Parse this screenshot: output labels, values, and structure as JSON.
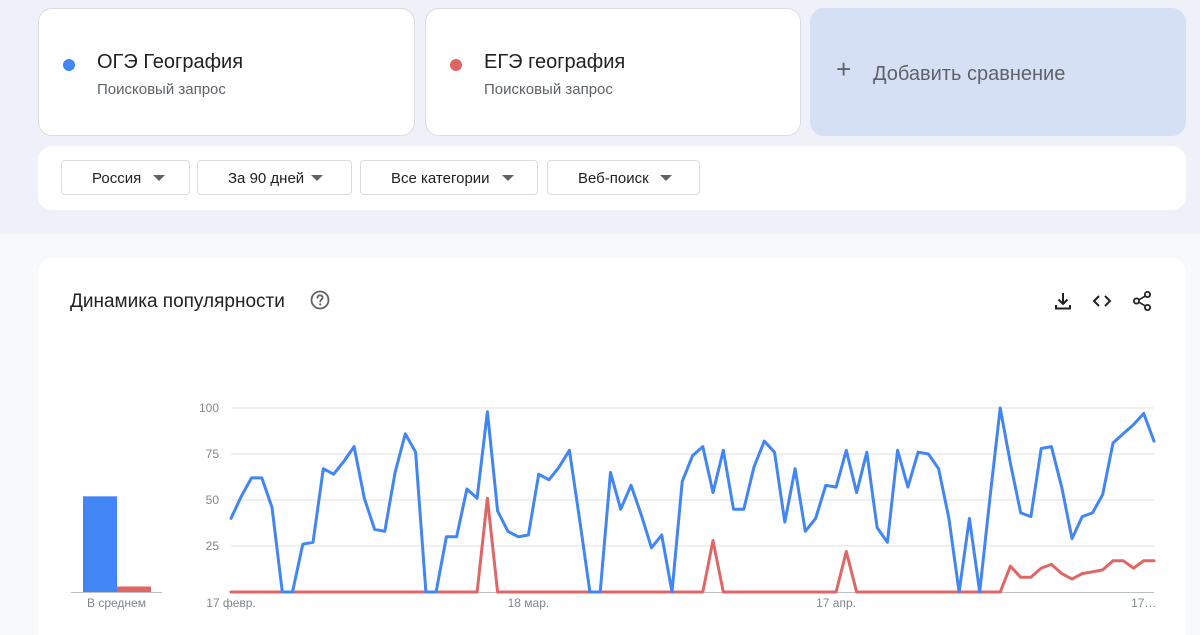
{
  "terms": [
    {
      "name": "ОГЭ География",
      "subtitle": "Поисковый запрос",
      "color": "#4285f4"
    },
    {
      "name": "ЕГЭ география",
      "subtitle": "Поисковый запрос",
      "color": "#e06666"
    }
  ],
  "add_comparison": {
    "icon": "plus-icon",
    "label": "Добавить сравнение"
  },
  "filters": [
    {
      "label": "Россия"
    },
    {
      "label": "За 90 дней"
    },
    {
      "label": "Все категории"
    },
    {
      "label": "Веб-поиск"
    }
  ],
  "chart_card": {
    "title": "Динамика популярности",
    "icons": [
      "help-icon",
      "download-icon",
      "embed-icon",
      "share-icon"
    ]
  },
  "chart_data": {
    "type": "line",
    "y_ticks": [
      "100",
      "75",
      "50",
      "25"
    ],
    "ylim": [
      0,
      100
    ],
    "x_tick_labels": [
      "17 февр.",
      "18 мар.",
      "17 апр.",
      "17…"
    ],
    "x_tick_indices": [
      0,
      29,
      59,
      89
    ],
    "grid": true,
    "average_label": "В среднем",
    "averages": [
      52,
      3
    ],
    "series": [
      {
        "name": "ОГЭ География",
        "color": "#4285f4",
        "values": [
          40,
          52,
          62,
          62,
          46,
          0,
          0,
          26,
          27,
          67,
          64,
          71,
          79,
          51,
          34,
          33,
          65,
          86,
          76,
          0,
          0,
          30,
          30,
          56,
          51,
          98,
          44,
          33,
          30,
          31,
          64,
          61,
          68,
          77,
          39,
          0,
          0,
          65,
          45,
          58,
          42,
          24,
          31,
          0,
          60,
          74,
          79,
          54,
          77,
          45,
          45,
          68,
          82,
          76,
          38,
          67,
          33,
          40,
          58,
          57,
          77,
          54,
          76,
          35,
          27,
          77,
          57,
          76,
          75,
          67,
          40,
          0,
          40,
          0,
          51,
          100,
          70,
          43,
          41,
          78,
          79,
          57,
          29,
          41,
          43,
          53,
          81,
          86,
          91,
          97,
          82
        ]
      },
      {
        "name": "ЕГЭ география",
        "color": "#e06666",
        "values": [
          0,
          0,
          0,
          0,
          0,
          0,
          0,
          0,
          0,
          0,
          0,
          0,
          0,
          0,
          0,
          0,
          0,
          0,
          0,
          0,
          0,
          0,
          0,
          0,
          0,
          51,
          0,
          0,
          0,
          0,
          0,
          0,
          0,
          0,
          0,
          0,
          0,
          0,
          0,
          0,
          0,
          0,
          0,
          0,
          0,
          0,
          0,
          28,
          0,
          0,
          0,
          0,
          0,
          0,
          0,
          0,
          0,
          0,
          0,
          0,
          22,
          0,
          0,
          0,
          0,
          0,
          0,
          0,
          0,
          0,
          0,
          0,
          0,
          0,
          0,
          0,
          14,
          8,
          8,
          13,
          15,
          10,
          7,
          10,
          11,
          12,
          17,
          17,
          13,
          17,
          17
        ]
      }
    ]
  }
}
